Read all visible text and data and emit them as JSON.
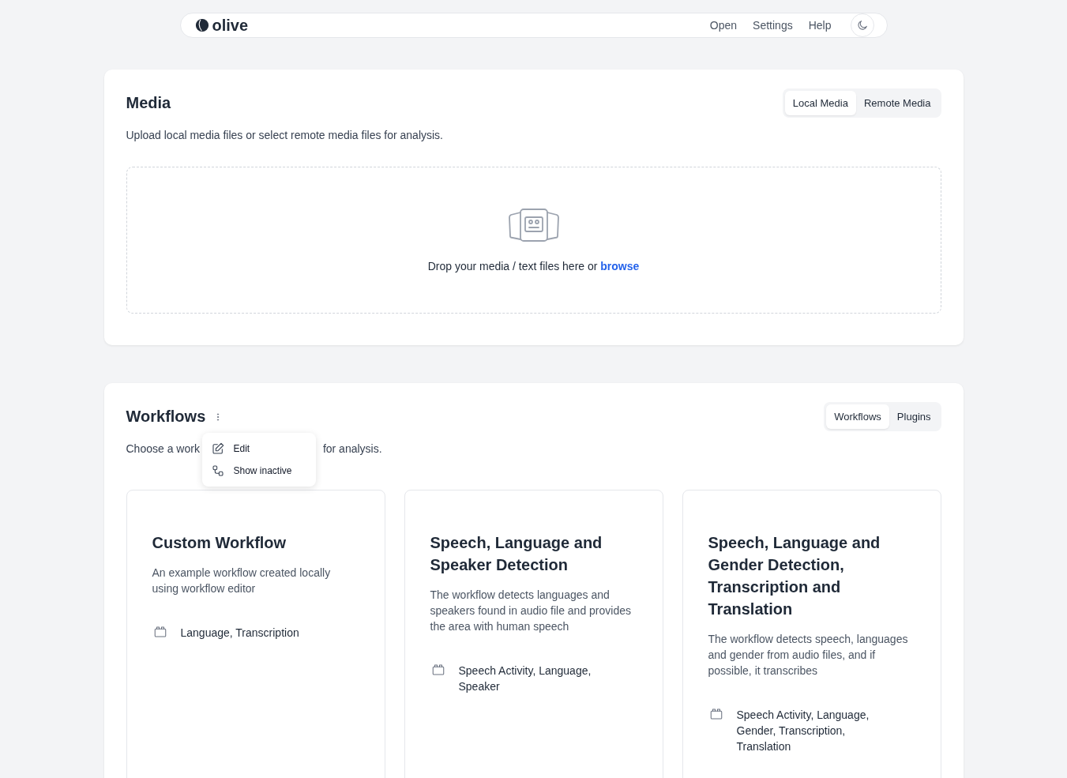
{
  "nav": {
    "brand": "olive",
    "links": [
      "Open",
      "Settings",
      "Help"
    ]
  },
  "media": {
    "title": "Media",
    "description": "Upload local media files or select remote media files for analysis.",
    "tabs": [
      {
        "label": "Local Media",
        "selected": true
      },
      {
        "label": "Remote Media",
        "selected": false
      }
    ],
    "dropzone": {
      "text": "Drop your media / text files here or ",
      "link": "browse"
    }
  },
  "workflows": {
    "title": "Workflows",
    "description_parts": [
      "Choose a work",
      "for analysis."
    ],
    "tabs": [
      {
        "label": "Workflows",
        "selected": true
      },
      {
        "label": "Plugins",
        "selected": false
      }
    ],
    "menu": [
      {
        "kind": "edit",
        "label": "Edit"
      },
      {
        "kind": "inactive",
        "label": "Show inactive"
      }
    ],
    "cards": [
      {
        "title": "Custom Workflow",
        "description": "An example workflow created locally using workflow editor",
        "tags": "Language, Transcription"
      },
      {
        "title": "Speech, Language and Speaker Detection",
        "description": "The workflow detects languages and speakers found in audio file and provides the area with human speech",
        "tags": "Speech Activity, Language, Speaker"
      },
      {
        "title": "Speech, Language and Gender Detection, Transcription and Translation",
        "description": "The workflow detects speech, languages and gender from audio files, and if possible, it transcribes",
        "tags": "Speech Activity, Language, Gender, Transcription, Translation"
      }
    ]
  }
}
